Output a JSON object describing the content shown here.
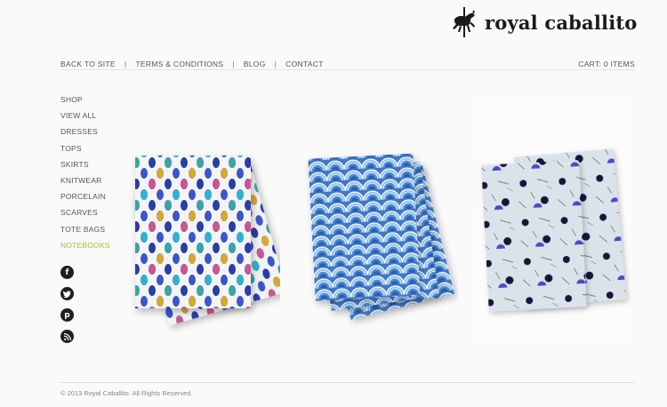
{
  "brand": {
    "name": "royal caballito"
  },
  "topnav": {
    "items": [
      "BACK TO SITE",
      "TERMS & CONDITIONS",
      "BLOG",
      "CONTACT"
    ],
    "cart": "CART: 0 ITEMS"
  },
  "sidebar": {
    "items": [
      "SHOP",
      "VIEW ALL",
      "DRESSES",
      "TOPS",
      "SKIRTS",
      "KNITWEAR",
      "PORCELAIN",
      "SCARVES",
      "TOTE BAGS",
      "NOTEBOOKS"
    ],
    "active": "NOTEBOOKS"
  },
  "social": {
    "icons": [
      "facebook-icon",
      "twitter-icon",
      "pinterest-icon",
      "rss-icon"
    ]
  },
  "products": [
    {
      "name": "notebook-polka-dots"
    },
    {
      "name": "notebook-waves"
    },
    {
      "name": "notebook-geometric"
    }
  ],
  "footer": {
    "copyright": "© 2013 Royal Caballito. All Rights Reserved."
  },
  "colors": {
    "accent": "#9ac13b",
    "text": "#555555",
    "rule": "#e3e3e3"
  }
}
